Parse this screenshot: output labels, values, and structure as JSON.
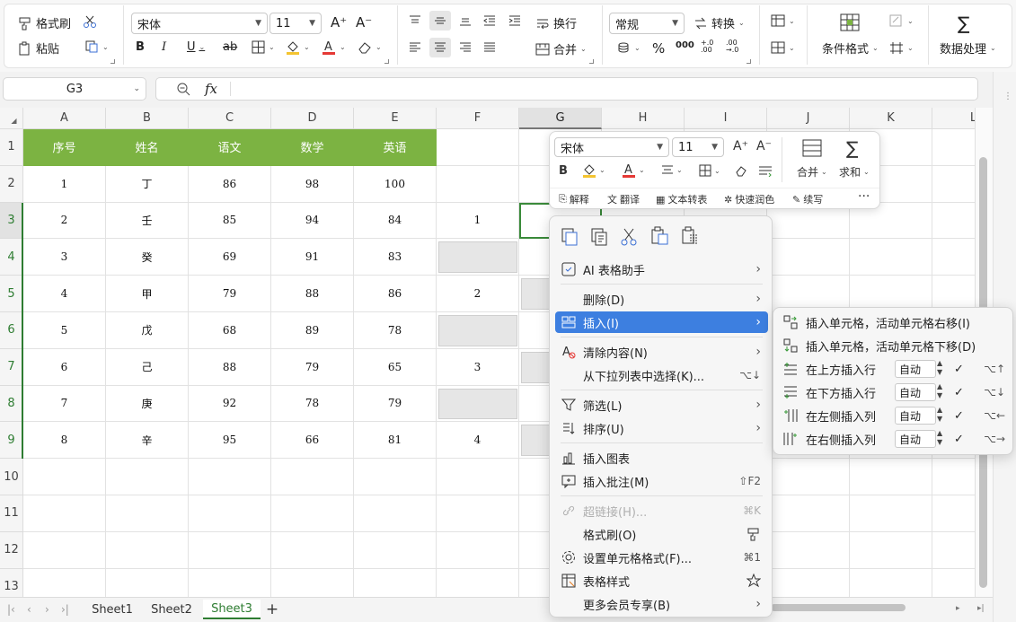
{
  "ribbon": {
    "format_painter": "格式刷",
    "paste": "粘贴",
    "font_name": "宋体",
    "font_size": "11",
    "bold": "B",
    "italic": "I",
    "underline": "U",
    "strike": "ab",
    "wrap": "换行",
    "merge": "合并",
    "number_format": "常规",
    "convert": "转换",
    "percent": "%",
    "thousands": "000",
    "inc_decimal": "+.0 .00",
    "dec_decimal": ".00 →.0",
    "conditional": "条件格式",
    "data_process": "数据处理"
  },
  "formula": {
    "name_box": "G3",
    "fx": "fx"
  },
  "grid": {
    "columns": [
      "A",
      "B",
      "C",
      "D",
      "E",
      "F",
      "G",
      "H",
      "I",
      "J",
      "K",
      "L"
    ],
    "rows": [
      "1",
      "2",
      "3",
      "4",
      "5",
      "6",
      "7",
      "8",
      "9",
      "10",
      "11",
      "12",
      "13"
    ],
    "headers": [
      "序号",
      "姓名",
      "语文",
      "数学",
      "英语"
    ],
    "data": [
      [
        "1",
        "丁",
        "86",
        "98",
        "100"
      ],
      [
        "2",
        "壬",
        "85",
        "94",
        "84"
      ],
      [
        "3",
        "癸",
        "69",
        "91",
        "83"
      ],
      [
        "4",
        "甲",
        "79",
        "88",
        "86"
      ],
      [
        "5",
        "戊",
        "68",
        "89",
        "78"
      ],
      [
        "6",
        "己",
        "88",
        "79",
        "65"
      ],
      [
        "7",
        "庚",
        "92",
        "78",
        "79"
      ],
      [
        "8",
        "辛",
        "95",
        "66",
        "81"
      ]
    ],
    "f_values": {
      "r3": "1",
      "r5": "2",
      "r7": "3",
      "r9": "4"
    }
  },
  "sheets": [
    "Sheet1",
    "Sheet2",
    "Sheet3"
  ],
  "add_sheet": "+",
  "mini_toolbar": {
    "font_name": "宋体",
    "font_size": "11",
    "bold": "B",
    "merge": "合并",
    "sum": "求和",
    "explain": "解释",
    "translate": "翻译",
    "text_to_table": "文本转表",
    "quick_color": "快速润色",
    "continue_write": "续写",
    "more": "···"
  },
  "context_menu": {
    "ai_assistant": "AI 表格助手",
    "delete": "删除(D)",
    "insert": "插入(I)",
    "clear": "清除内容(N)",
    "pick_from_list": "从下拉列表中选择(K)...",
    "pick_from_list_shortcut": "⌥↓",
    "filter": "筛选(L)",
    "sort": "排序(U)",
    "insert_chart": "插入图表",
    "insert_comment": "插入批注(M)",
    "insert_comment_shortcut": "⇧F2",
    "hyperlink": "超链接(H)...",
    "hyperlink_shortcut": "⌘K",
    "format_painter": "格式刷(O)",
    "cell_format": "设置单元格格式(F)...",
    "cell_format_shortcut": "⌘1",
    "table_style": "表格样式",
    "vip": "更多会员专享(B)"
  },
  "submenu": {
    "shift_right": "插入单元格，活动单元格右移(I)",
    "shift_down": "插入单元格，活动单元格下移(D)",
    "row_above": "在上方插入行",
    "row_below": "在下方插入行",
    "col_left": "在左侧插入列",
    "col_right": "在右侧插入列",
    "auto": "自动",
    "check": "✓",
    "sc_row_above": "⌥↑",
    "sc_row_below": "⌥↓",
    "sc_col_left": "⌥←",
    "sc_col_right": "⌥→"
  },
  "colors": {
    "header_green": "#7cb342",
    "accent_green": "#2e7d32",
    "menu_highlight": "#3d7fe0"
  }
}
